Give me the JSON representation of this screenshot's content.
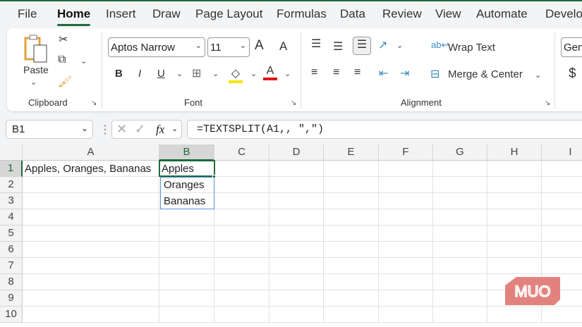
{
  "tabs": [
    "File",
    "Home",
    "Insert",
    "Draw",
    "Page Layout",
    "Formulas",
    "Data",
    "Review",
    "View",
    "Automate",
    "Develop"
  ],
  "ribbon": {
    "clipboard": {
      "paste": "Paste",
      "label": "Clipboard"
    },
    "font": {
      "name": "Aptos Narrow",
      "size": "11",
      "label": "Font",
      "bold": "B",
      "italic": "I",
      "underline": "U",
      "font_color": "A",
      "grow": "A",
      "shrink": "A"
    },
    "alignment": {
      "wrap": "Wrap Text",
      "merge": "Merge & Center",
      "label": "Alignment"
    },
    "number": {
      "format": "Gen",
      "currency": "$"
    }
  },
  "formula_bar": {
    "name_box": "B1",
    "fx": "fx",
    "formula": "=TEXTSPLIT(A1,, \",\")"
  },
  "columns": [
    "A",
    "B",
    "C",
    "D",
    "E",
    "F",
    "G",
    "H",
    "I"
  ],
  "rows": [
    "1",
    "2",
    "3",
    "4",
    "5",
    "6",
    "7",
    "8",
    "9",
    "10"
  ],
  "cells": {
    "A1": "Apples, Oranges, Bananas",
    "B1": "Apples",
    "B2": "Oranges",
    "B3": "Bananas"
  },
  "watermark": "MUO",
  "colors": {
    "accent": "#1e6b3c",
    "spill": "#5b8fd6",
    "logo": "#e07b77"
  }
}
